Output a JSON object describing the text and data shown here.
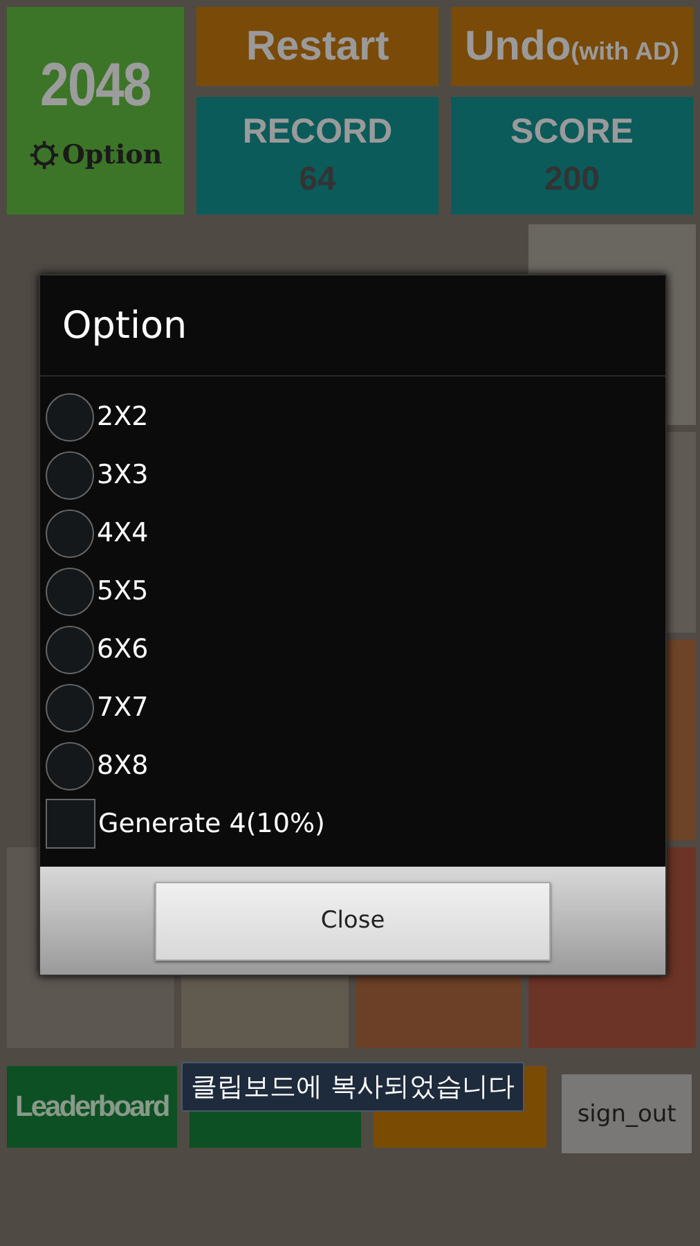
{
  "header": {
    "logo": "2048",
    "option_button": "Option",
    "restart_button": "Restart",
    "undo_button": {
      "label": "Undo",
      "note": "(with AD)"
    },
    "stats": [
      {
        "label": "RECORD",
        "value": "64"
      },
      {
        "label": "SCORE",
        "value": "200"
      }
    ]
  },
  "board": {
    "rows": [
      [
        {
          "kind": "empty"
        },
        {
          "kind": "empty"
        },
        {
          "kind": "empty"
        },
        {
          "kind": "tile",
          "color": "#6a6660"
        }
      ],
      [
        {
          "kind": "empty"
        },
        {
          "kind": "covered"
        },
        {
          "kind": "covered"
        },
        {
          "kind": "tile",
          "color": "#5f5a53"
        }
      ],
      [
        {
          "kind": "empty"
        },
        {
          "kind": "covered"
        },
        {
          "kind": "covered"
        },
        {
          "kind": "tile",
          "color": "#6e4428"
        }
      ],
      [
        {
          "kind": "tile",
          "color": "#5c5751"
        },
        {
          "kind": "tile",
          "color": "#615a4f"
        },
        {
          "kind": "tile",
          "color": "#6b4027"
        },
        {
          "kind": "tile",
          "color": "#6b3426"
        }
      ]
    ]
  },
  "bottom_buttons": [
    {
      "label": "Leaderboard",
      "color": "#0c5024"
    },
    {
      "color": "#0c5024"
    },
    {
      "color": "#7a4b02"
    },
    {
      "label": "sign_out",
      "color": "#7a7876"
    }
  ],
  "dialog": {
    "title": "Option",
    "options": [
      {
        "label": "2X2",
        "selected": false
      },
      {
        "label": "3X3",
        "selected": false
      },
      {
        "label": "4X4",
        "selected": false
      },
      {
        "label": "5X5",
        "selected": false
      },
      {
        "label": "6X6",
        "selected": false
      },
      {
        "label": "7X7",
        "selected": false
      },
      {
        "label": "8X8",
        "selected": false
      }
    ],
    "checkbox": {
      "label": "Generate 4(10%)",
      "checked": false
    },
    "close_button": "Close"
  },
  "toast": "클립보드에 복사되었습니다"
}
